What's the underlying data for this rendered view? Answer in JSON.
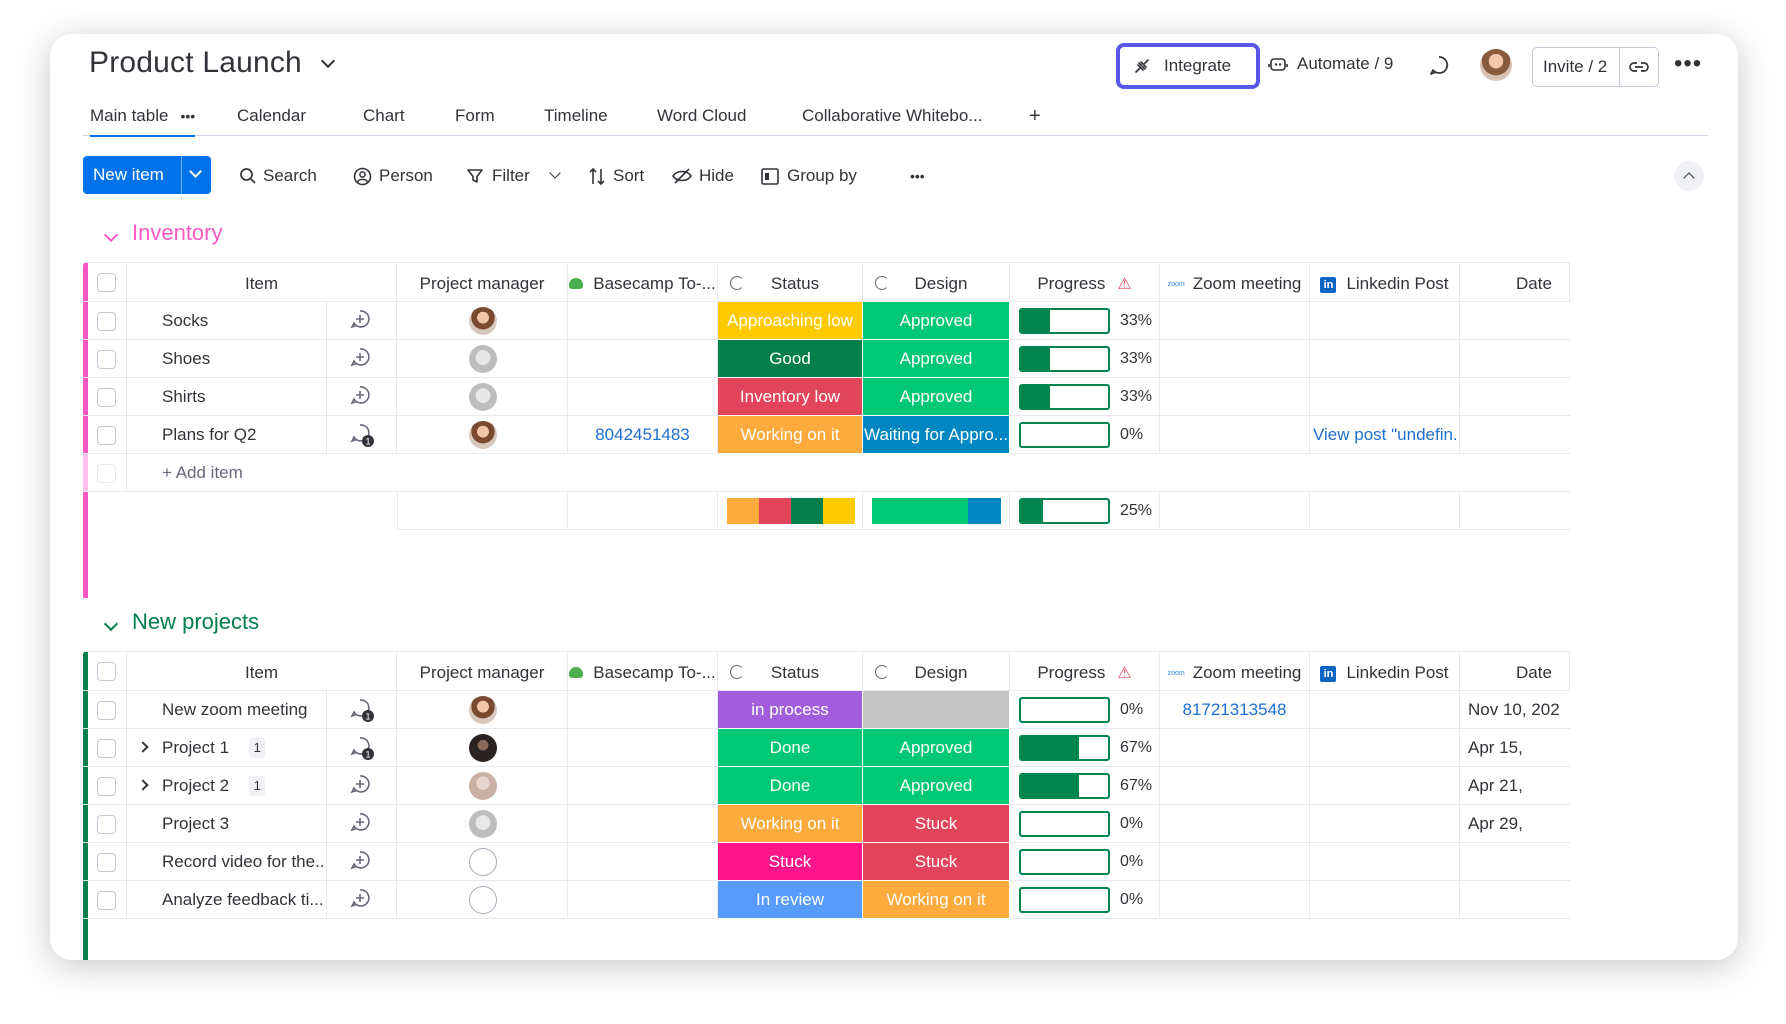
{
  "header": {
    "title": "Product Launch",
    "integrate_label": "Integrate",
    "automate_label": "Automate / 9",
    "invite_label": "Invite / 2"
  },
  "tabs": [
    {
      "label": "Main table"
    },
    {
      "label": "Calendar"
    },
    {
      "label": "Chart"
    },
    {
      "label": "Form"
    },
    {
      "label": "Timeline"
    },
    {
      "label": "Word Cloud"
    },
    {
      "label": "Collaborative Whitebo..."
    }
  ],
  "toolbar": {
    "new_item": "New item",
    "search": "Search",
    "person": "Person",
    "filter": "Filter",
    "sort": "Sort",
    "hide": "Hide",
    "group_by": "Group by"
  },
  "columns": {
    "item": "Item",
    "project_manager": "Project manager",
    "basecamp": "Basecamp To-...",
    "status": "Status",
    "design": "Design",
    "progress": "Progress",
    "zoom": "Zoom meeting",
    "linkedin": "Linkedin Post",
    "date": "Date"
  },
  "colors": {
    "approaching_low": "#ffcb00",
    "good": "#037f4c",
    "inventory_low": "#e2445c",
    "working_on_it": "#fdab3d",
    "approved": "#00c875",
    "waiting": "#0086c0",
    "in_process": "#a25ddc",
    "done": "#00c875",
    "stuck": "#e2445c",
    "stuck_pink": "#ff158a",
    "in_review": "#579bfc",
    "inventory_group": "#ff5ac4",
    "new_projects_group": "#037f4c"
  },
  "inventory": {
    "title": "Inventory",
    "add_item": "+ Add item",
    "rows": [
      {
        "item": "Socks",
        "status": "Approaching low",
        "status_color": "#ffcb00",
        "design": "Approved",
        "design_color": "#00c875",
        "progress": 33,
        "progress_label": "33%",
        "basecamp": "",
        "linkedin": "",
        "avatar": "photo"
      },
      {
        "item": "Shoes",
        "status": "Good",
        "status_color": "#037f4c",
        "design": "Approved",
        "design_color": "#00c875",
        "progress": 33,
        "progress_label": "33%",
        "basecamp": "",
        "linkedin": "",
        "avatar": "gray"
      },
      {
        "item": "Shirts",
        "status": "Inventory low",
        "status_color": "#e2445c",
        "design": "Approved",
        "design_color": "#00c875",
        "progress": 33,
        "progress_label": "33%",
        "basecamp": "",
        "linkedin": "",
        "avatar": "gray"
      },
      {
        "item": "Plans for Q2",
        "status": "Working on it",
        "status_color": "#fdab3d",
        "design": "Waiting for Appro...",
        "design_color": "#0086c0",
        "progress": 0,
        "progress_label": "0%",
        "basecamp": "8042451483",
        "linkedin": "View post \"undefin...",
        "avatar": "photo",
        "updates": "1"
      }
    ],
    "summary_progress": 25,
    "summary_progress_label": "25%"
  },
  "new_projects": {
    "title": "New projects",
    "rows": [
      {
        "item": "New zoom meeting",
        "status": "in process",
        "status_color": "#a25ddc",
        "design": "",
        "design_color": "#c4c4c4",
        "progress": 0,
        "progress_label": "0%",
        "zoom": "81721313548",
        "date": "Nov 10, 202",
        "avatar": "photo",
        "updates": "1"
      },
      {
        "item": "Project 1",
        "sub": "1",
        "status": "Done",
        "status_color": "#00c875",
        "design": "Approved",
        "design_color": "#00c875",
        "progress": 67,
        "progress_label": "67%",
        "zoom": "",
        "date": "Apr 15,",
        "avatar": "dark",
        "updates": "1"
      },
      {
        "item": "Project 2",
        "sub": "1",
        "status": "Done",
        "status_color": "#00c875",
        "design": "Approved",
        "design_color": "#00c875",
        "progress": 67,
        "progress_label": "67%",
        "zoom": "",
        "date": "Apr 21,",
        "avatar": "light"
      },
      {
        "item": "Project 3",
        "status": "Working on it",
        "status_color": "#fdab3d",
        "design": "Stuck",
        "design_color": "#e2445c",
        "progress": 0,
        "progress_label": "0%",
        "zoom": "",
        "date": "Apr 29,",
        "avatar": "gray"
      },
      {
        "item": "Record video for the...",
        "status": "Stuck",
        "status_color": "#ff158a",
        "design": "Stuck",
        "design_color": "#e2445c",
        "progress": 0,
        "progress_label": "0%",
        "zoom": "",
        "date": "",
        "avatar": "empty"
      },
      {
        "item": "Analyze feedback ti...",
        "status": "In review",
        "status_color": "#579bfc",
        "design": "Working on it",
        "design_color": "#fdab3d",
        "progress": 0,
        "progress_label": "0%",
        "zoom": "",
        "date": "",
        "avatar": "empty"
      }
    ]
  }
}
